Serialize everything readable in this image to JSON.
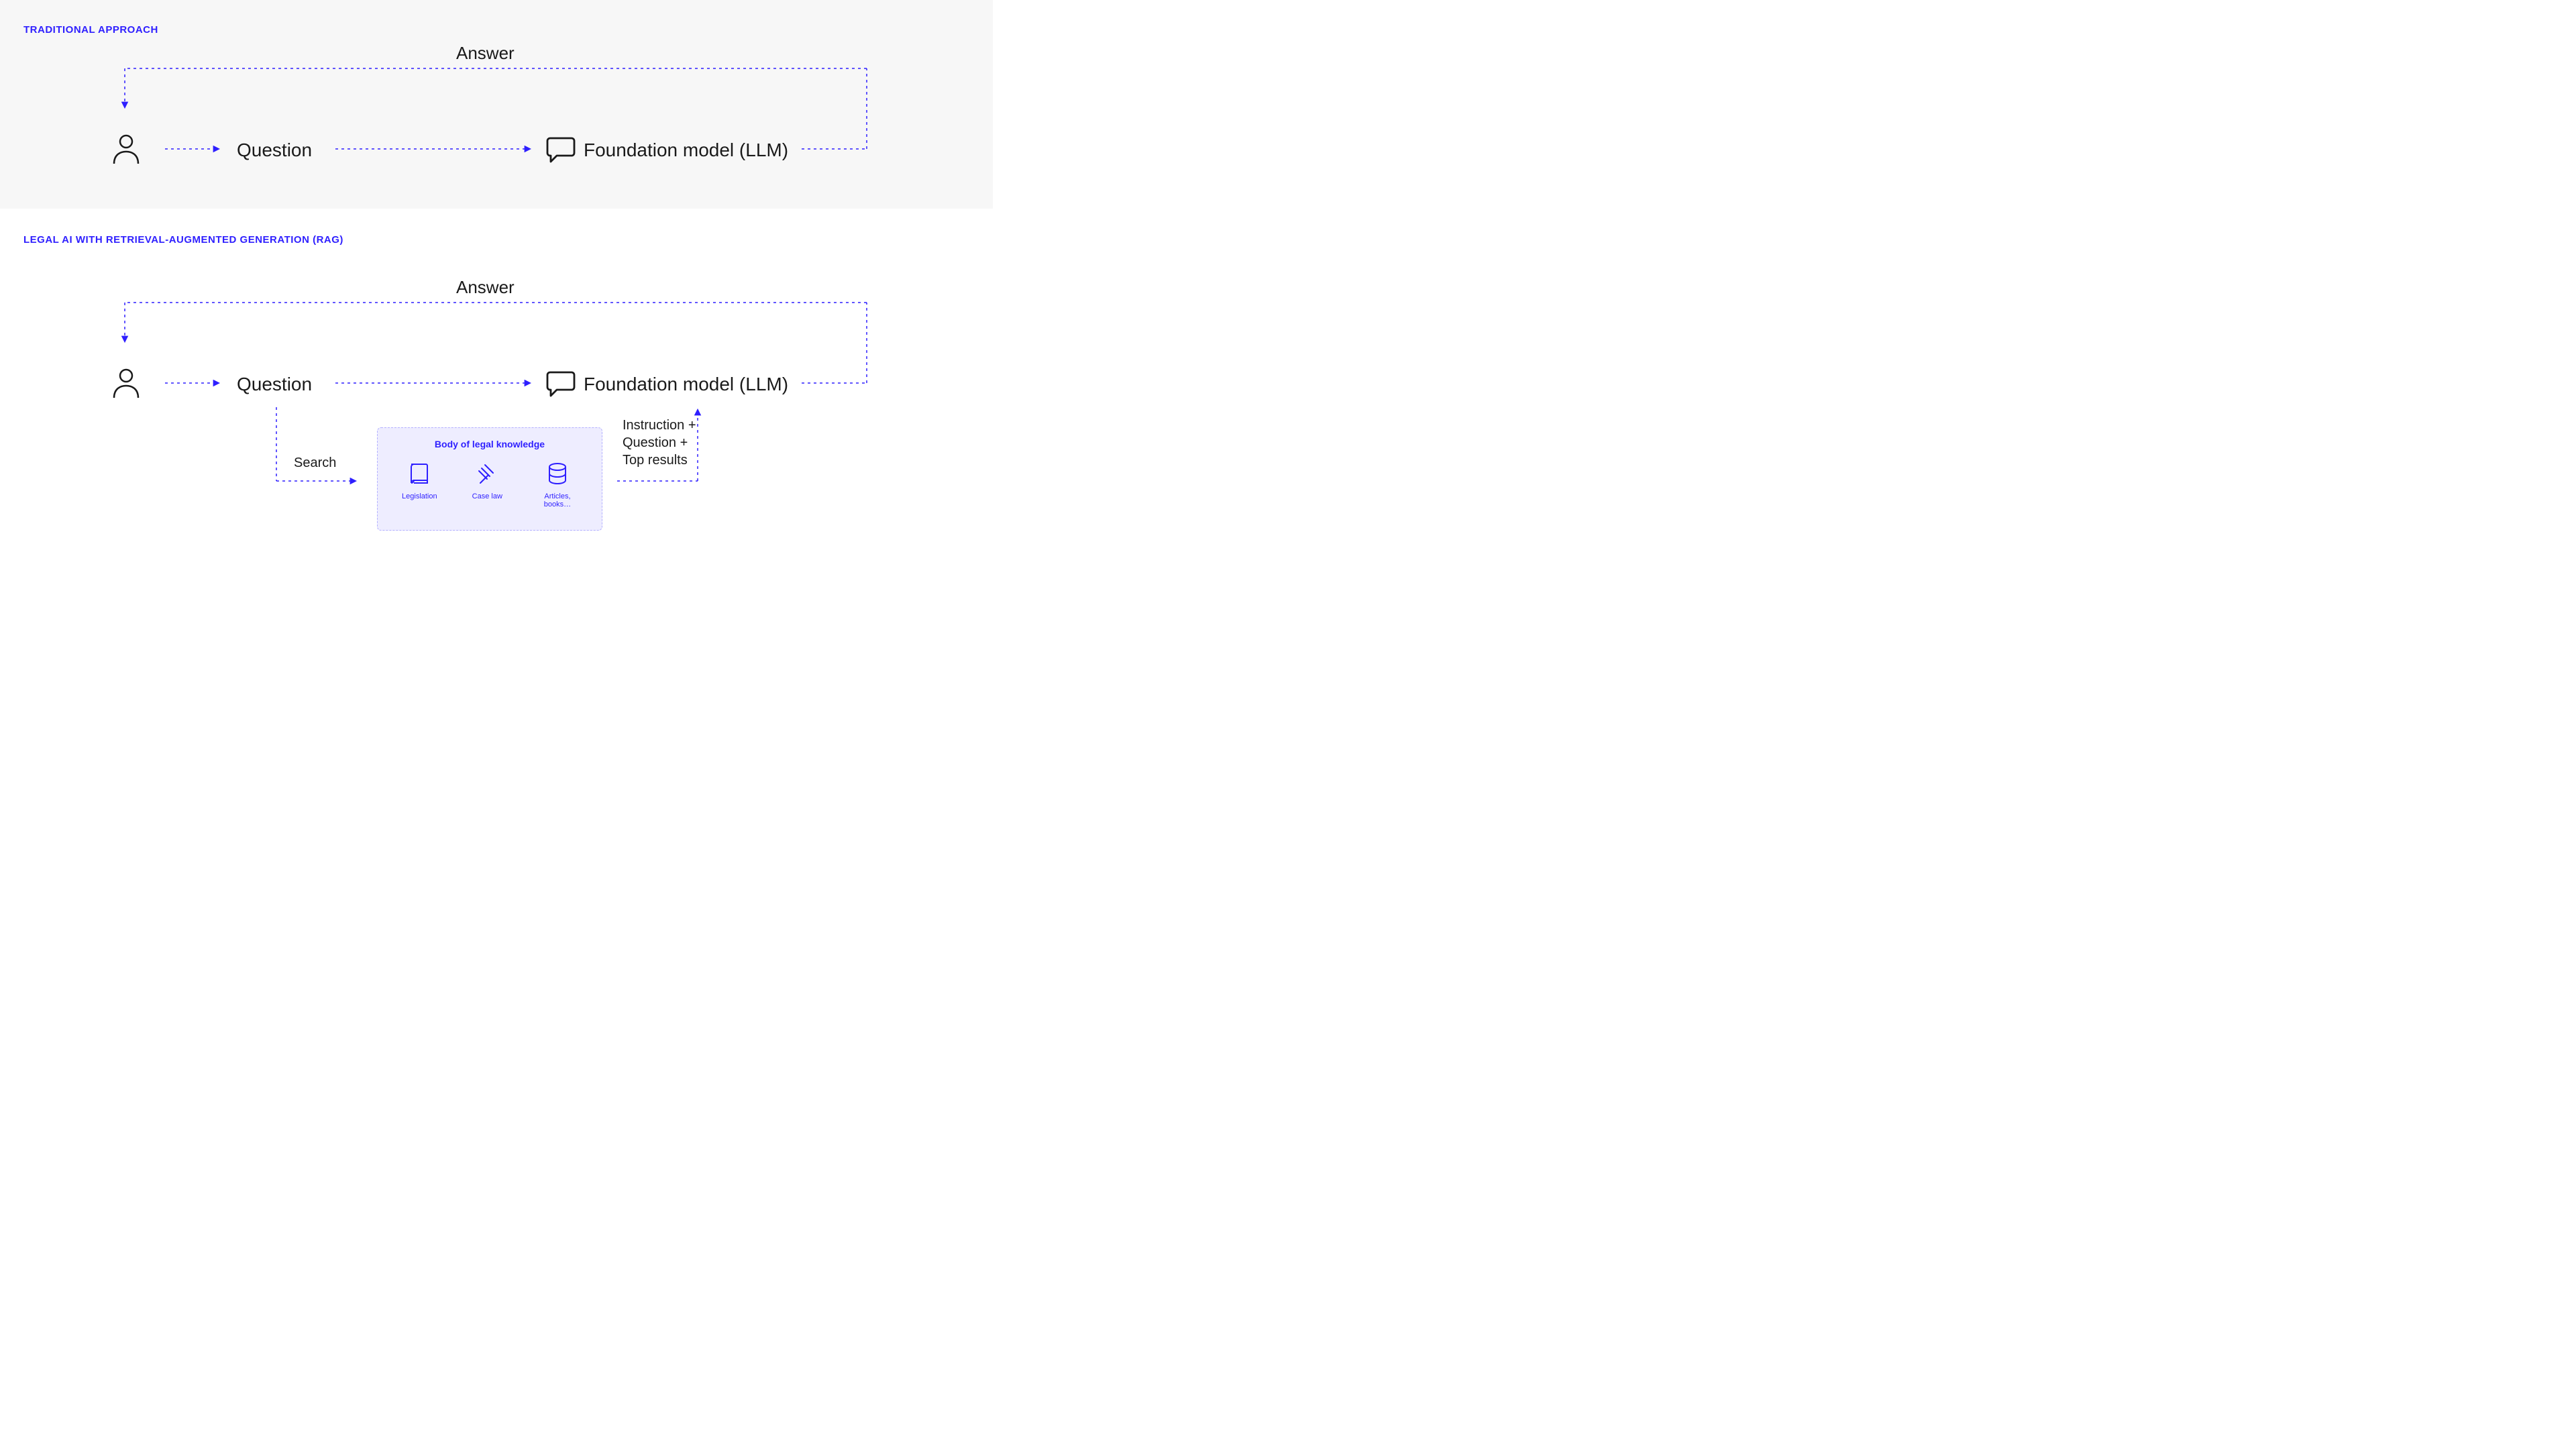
{
  "colors": {
    "accent": "#2e1fff"
  },
  "top": {
    "title": "TRADITIONAL APPROACH",
    "answer": "Answer",
    "question": "Question",
    "model": "Foundation model (LLM)"
  },
  "bottom": {
    "title": "LEGAL AI WITH RETRIEVAL-AUGMENTED GENERATION (RAG)",
    "answer": "Answer",
    "question": "Question",
    "model": "Foundation model (LLM)",
    "search": "Search",
    "instruction": "Instruction +\nQuestion +\nTop results",
    "kb": {
      "title": "Body of legal knowledge",
      "items": [
        {
          "icon": "book",
          "label": "Legislation"
        },
        {
          "icon": "gavel",
          "label": "Case law"
        },
        {
          "icon": "db",
          "label": "Articles, books…"
        }
      ]
    }
  }
}
